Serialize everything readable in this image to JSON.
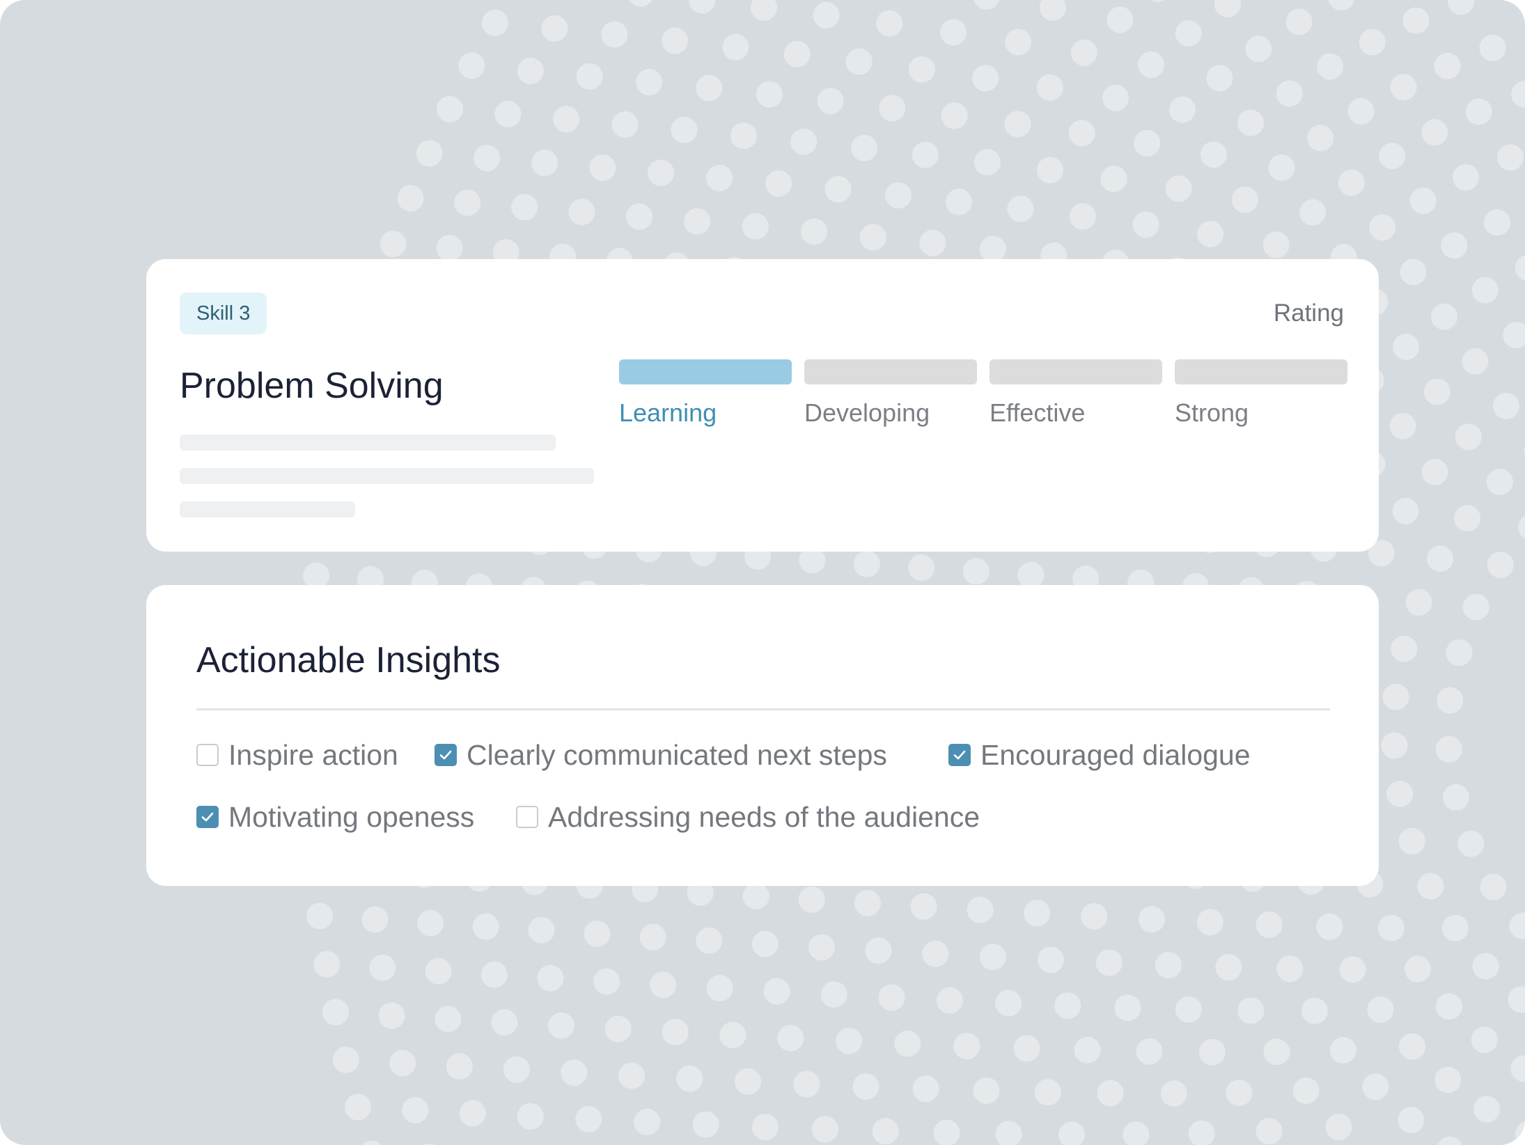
{
  "skill": {
    "badge": "Skill 3",
    "title": "Problem Solving",
    "rating_label": "Rating",
    "levels": [
      {
        "label": "Learning",
        "active": true
      },
      {
        "label": "Developing",
        "active": false
      },
      {
        "label": "Effective",
        "active": false
      },
      {
        "label": "Strong",
        "active": false
      }
    ]
  },
  "insights": {
    "title": "Actionable Insights",
    "items": [
      {
        "label": "Inspire action",
        "checked": false
      },
      {
        "label": "Clearly communicated next steps",
        "checked": true
      },
      {
        "label": "Encouraged dialogue",
        "checked": true
      },
      {
        "label": "Motivating openess",
        "checked": true
      },
      {
        "label": "Addressing needs of the audience",
        "checked": false
      }
    ]
  },
  "colors": {
    "background": "#d6dbdf",
    "accent": "#4c8fb3",
    "active_segment": "#99cbe5",
    "badge_bg": "#e3f3fa"
  }
}
